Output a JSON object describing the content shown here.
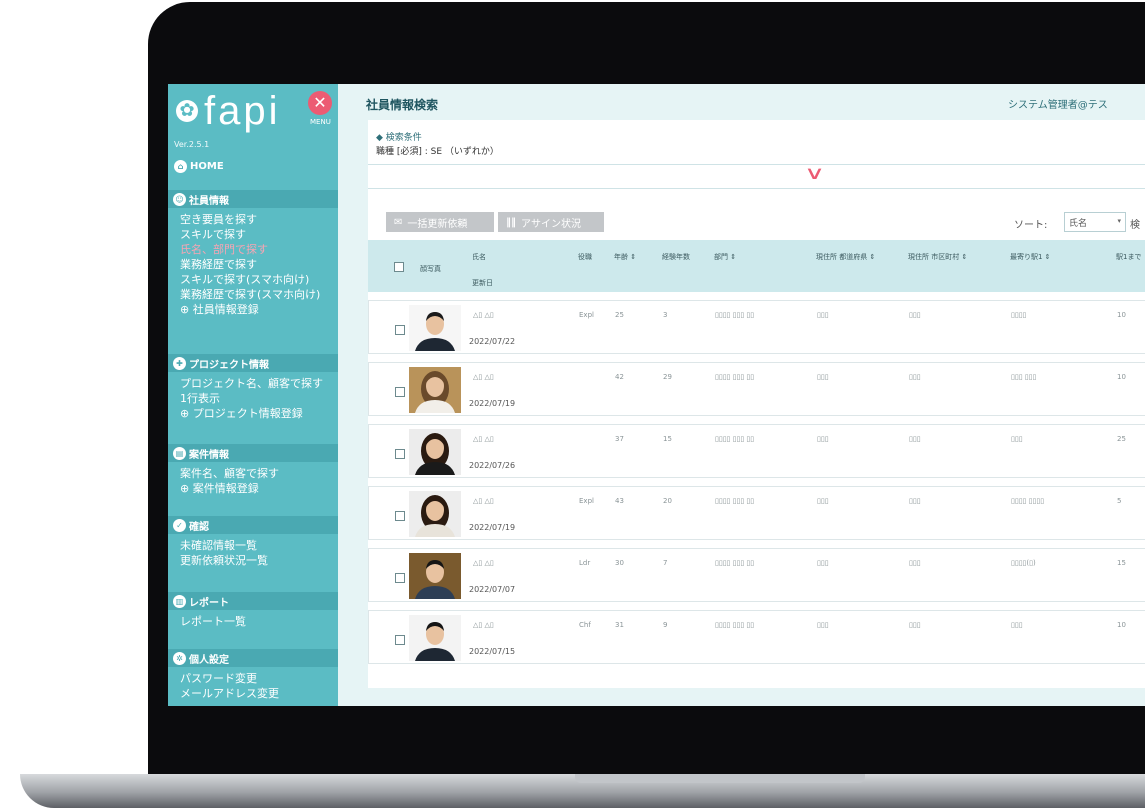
{
  "app": {
    "logo_text": "fapi",
    "menu_close_label": "MENU",
    "version": "Ver.2.5.1",
    "page_title": "社員情報検索",
    "user_label": "システム管理者@テス"
  },
  "sidebar": {
    "home": "HOME",
    "sections": [
      {
        "title": "社員情報",
        "icon": "people-icon",
        "items": [
          "空き要員を探す",
          "スキルで探す",
          "氏名、部門で探す",
          "業務経歴で探す",
          "スキルで探す(スマホ向け)",
          "業務経歴で探す(スマホ向け)",
          "⊕ 社員情報登録"
        ],
        "active": 2
      },
      {
        "title": "プロジェクト情報",
        "icon": "project-icon",
        "items": [
          "プロジェクト名、顧客で探す",
          "1行表示",
          "⊕ プロジェクト情報登録"
        ],
        "active": -1
      },
      {
        "title": "案件情報",
        "icon": "document-icon",
        "items": [
          "案件名、顧客で探す",
          "⊕ 案件情報登録"
        ],
        "active": -1
      },
      {
        "title": "確認",
        "icon": "check-icon",
        "items": [
          "未確認情報一覧",
          "更新依頼状況一覧"
        ],
        "active": -1
      },
      {
        "title": "レポート",
        "icon": "chart-icon",
        "items": [
          "レポート一覧"
        ],
        "active": -1
      },
      {
        "title": "個人設定",
        "icon": "gear-icon",
        "items": [
          "パスワード変更",
          "メールアドレス変更"
        ],
        "active": -1
      }
    ]
  },
  "search": {
    "condition_header": "◆ 検索条件",
    "condition_text": "職種 [必須] : SE （いずれか）"
  },
  "toolbar": {
    "bulk_update": "一括更新依頼",
    "assign_status": "アサイン状況",
    "sort_label": "ソート:",
    "sort_value": "氏名",
    "sort_extra": "検"
  },
  "table": {
    "headers": {
      "photo": "顔写真",
      "name": "氏名",
      "updated": "更新日",
      "title": "役職",
      "age": "年齢 ⇕",
      "years": "経験年数",
      "dept": "部門 ⇕",
      "pref": "現住所 都道府県 ⇕",
      "city": "現住所 市区町村 ⇕",
      "station": "最寄り駅1 ⇕",
      "walk": "駅1まで"
    },
    "rows": [
      {
        "name": "△▯ △▯",
        "role": "Expl",
        "age": "25",
        "years": "3",
        "dept": "▯▯▯▯ ▯▯▯ ▯▯",
        "pref": "▯▯▯",
        "city": "▯▯▯",
        "station": "▯▯▯▯",
        "walk": "10",
        "date": "2022/07/22"
      },
      {
        "name": "△▯ △▯",
        "role": "",
        "age": "42",
        "years": "29",
        "dept": "▯▯▯▯ ▯▯▯ ▯▯",
        "pref": "▯▯▯",
        "city": "▯▯▯",
        "station": "▯▯▯ ▯▯▯",
        "walk": "10",
        "date": "2022/07/19"
      },
      {
        "name": "△▯ △▯",
        "role": "",
        "age": "37",
        "years": "15",
        "dept": "▯▯▯▯ ▯▯▯ ▯▯",
        "pref": "▯▯▯",
        "city": "▯▯▯",
        "station": "▯▯▯",
        "walk": "25",
        "date": "2022/07/26"
      },
      {
        "name": "△▯ △▯",
        "role": "Expl",
        "age": "43",
        "years": "20",
        "dept": "▯▯▯▯ ▯▯▯ ▯▯",
        "pref": "▯▯▯",
        "city": "▯▯▯",
        "station": "▯▯▯▯ ▯▯▯▯",
        "walk": "5",
        "date": "2022/07/19"
      },
      {
        "name": "△▯ △▯",
        "role": "Ldr",
        "age": "30",
        "years": "7",
        "dept": "▯▯▯▯ ▯▯▯ ▯▯",
        "pref": "▯▯▯",
        "city": "▯▯▯",
        "station": "▯▯▯▯(▯)",
        "walk": "15",
        "date": "2022/07/07"
      },
      {
        "name": "△▯ △▯",
        "role": "Chf",
        "age": "31",
        "years": "9",
        "dept": "▯▯▯▯ ▯▯▯ ▯▯",
        "pref": "▯▯▯",
        "city": "▯▯▯",
        "station": "▯▯▯",
        "walk": "10",
        "date": "2022/07/15"
      }
    ]
  },
  "colors": {
    "sidebar": "#5bbcc4",
    "accent": "#ec5b73",
    "header_row": "#cde9ec"
  }
}
